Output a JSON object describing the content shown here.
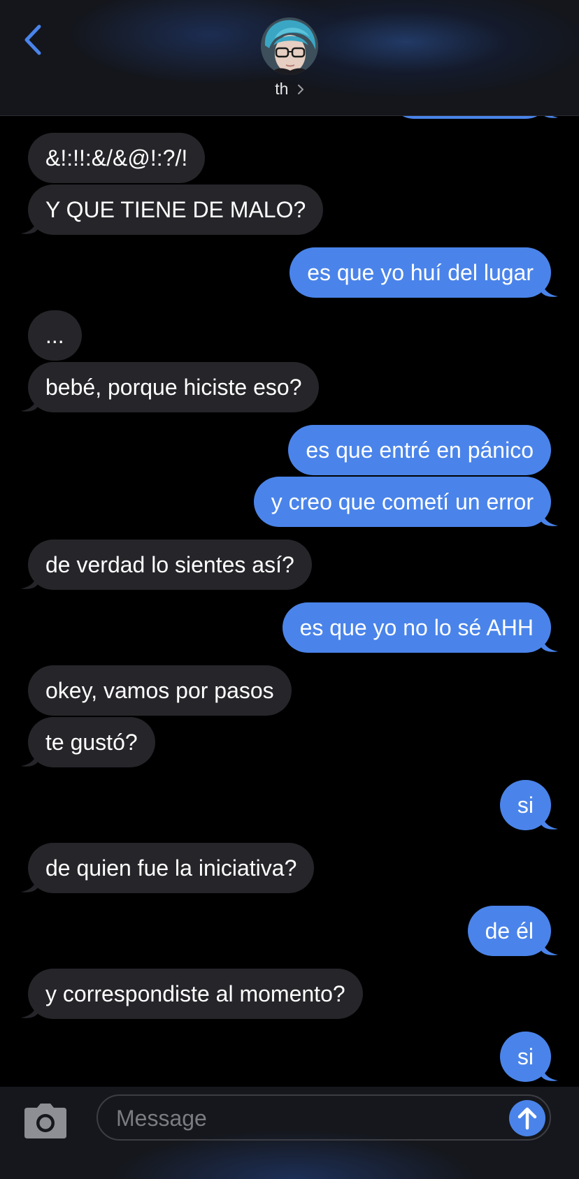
{
  "header": {
    "contact_name": "th",
    "accent_color": "#4a84ea"
  },
  "messages": [
    {
      "side": "out",
      "text": "",
      "partial": true
    },
    {
      "side": "in",
      "text": "&!:!!:&/&@!:?/!"
    },
    {
      "side": "in",
      "text": "Y QUE TIENE DE MALO?"
    },
    {
      "side": "out",
      "text": "es que yo huí del lugar"
    },
    {
      "side": "in",
      "text": "..."
    },
    {
      "side": "in",
      "text": "bebé, porque hiciste eso?"
    },
    {
      "side": "out",
      "text": "es que entré en pánico"
    },
    {
      "side": "out",
      "text": "y creo que cometí un error"
    },
    {
      "side": "in",
      "text": "de verdad lo sientes así?"
    },
    {
      "side": "out",
      "text": "es que yo no lo sé AHH"
    },
    {
      "side": "in",
      "text": "okey, vamos por pasos"
    },
    {
      "side": "in",
      "text": "te gustó?"
    },
    {
      "side": "out",
      "text": "si"
    },
    {
      "side": "in",
      "text": "de quien fue la iniciativa?"
    },
    {
      "side": "out",
      "text": "de él"
    },
    {
      "side": "in",
      "text": "y correspondiste al momento?"
    },
    {
      "side": "out",
      "text": "si"
    }
  ],
  "composer": {
    "placeholder": "Message"
  },
  "colors": {
    "incoming_bubble": "#26252a",
    "outgoing_bubble": "#4a84ea",
    "background": "#000000"
  },
  "icons": {
    "back": "chevron-left-icon",
    "contact_chevron": "chevron-right-icon",
    "camera": "camera-icon",
    "send": "arrow-up-icon"
  }
}
